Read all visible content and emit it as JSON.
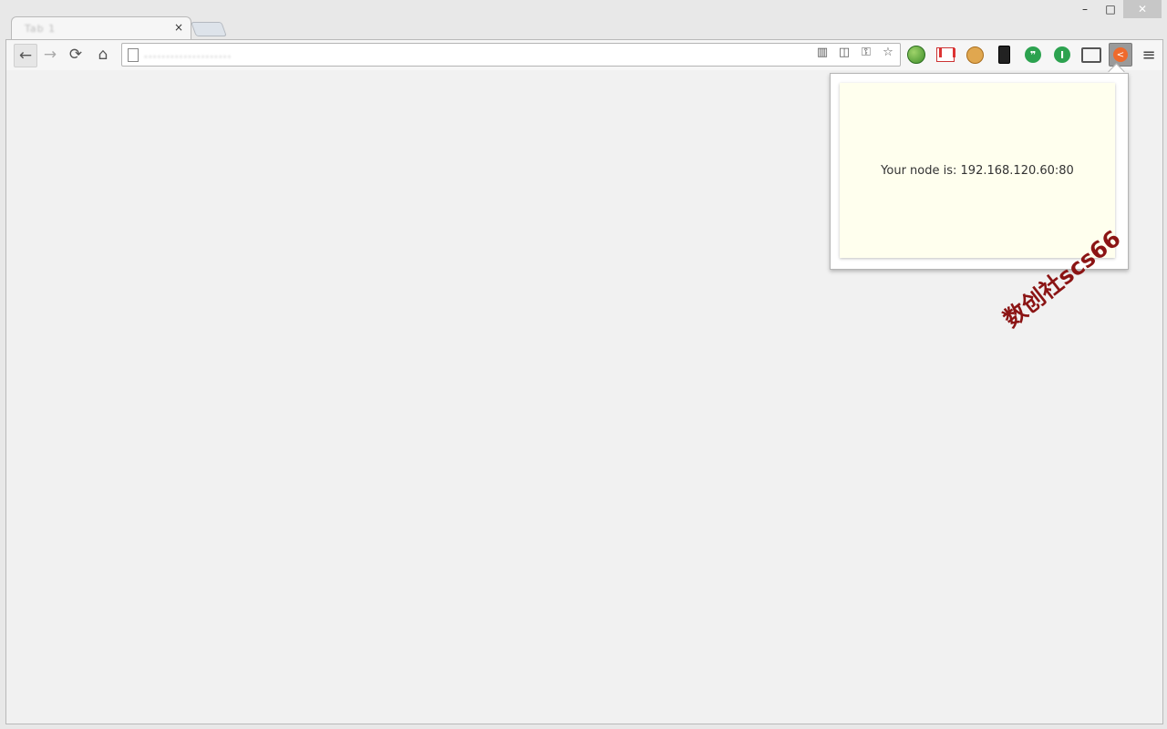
{
  "window": {
    "minimize_label": "–",
    "maximize_label": "□",
    "close_label": "✕"
  },
  "tabs": [
    {
      "title": "Tab 1",
      "close_label": "×"
    }
  ],
  "toolbar": {
    "back_icon": "←",
    "forward_icon": "→",
    "reload_icon": "⟳",
    "home_icon": "⌂",
    "menu_icon": "≡",
    "omnibox": {
      "url": "...................."
    },
    "omnibox_icons": [
      "iis-icon",
      "reader-icon",
      "key-icon",
      "star-icon"
    ],
    "extensions": [
      "globe-icon",
      "gmail-icon",
      "cookie-icon",
      "phone-icon",
      "hangouts-icon",
      "ibutton-icon",
      "cast-icon",
      "share-extension-icon"
    ]
  },
  "popup": {
    "text": "Your node is: 192.168.120.60:80"
  },
  "watermark": "数创社scs66",
  "colors": {
    "popup_bg": "#ffffee",
    "share_ext": "#ef6a2c",
    "watermark": "#8b1414"
  }
}
